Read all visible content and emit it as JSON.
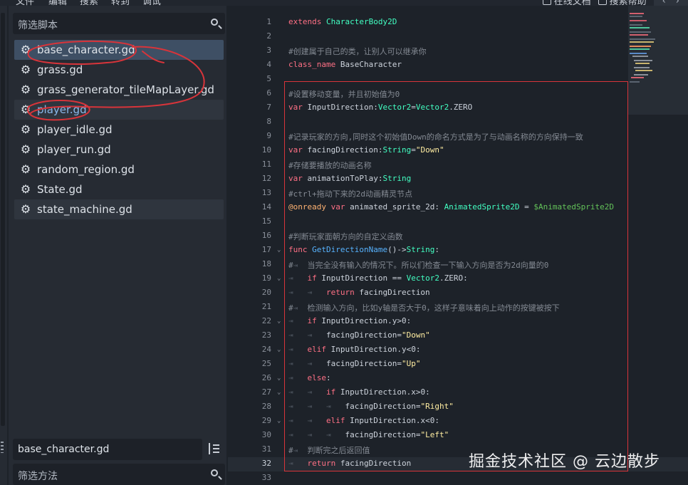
{
  "menubar": {
    "items": [
      "文件",
      "编辑",
      "搜索",
      "转到",
      "调试"
    ],
    "online_docs": "在线文档",
    "search_help": "搜索帮助",
    "nav_back": "‹",
    "nav_forward": "›"
  },
  "script_panel": {
    "filter_placeholder": "筛选脚本",
    "files": [
      {
        "name": "base_character.gd",
        "icon": "gear-icon",
        "state": "selected"
      },
      {
        "name": "grass.gd",
        "icon": "gear-icon",
        "state": "normal"
      },
      {
        "name": "grass_generator_tileMapLayer.gd",
        "icon": "gear-icon",
        "state": "normal"
      },
      {
        "name": "player.gd",
        "icon": "gear-icon",
        "state": "shaded"
      },
      {
        "name": "player_idle.gd",
        "icon": "gear-icon",
        "state": "normal"
      },
      {
        "name": "player_run.gd",
        "icon": "gear-icon",
        "state": "normal"
      },
      {
        "name": "random_region.gd",
        "icon": "gear-icon",
        "state": "normal"
      },
      {
        "name": "State.gd",
        "icon": "gear-icon",
        "state": "normal"
      },
      {
        "name": "state_machine.gd",
        "icon": "gear-icon",
        "state": "shaded"
      }
    ],
    "current_script": "base_character.gd",
    "method_filter_placeholder": "筛选方法"
  },
  "editor": {
    "current_line": 32,
    "lines": [
      {
        "n": "1",
        "fold": "",
        "segments": [
          {
            "c": "kw",
            "t": "extends "
          },
          {
            "c": "typ",
            "t": "CharacterBody2D"
          }
        ]
      },
      {
        "n": "2",
        "fold": "",
        "segments": []
      },
      {
        "n": "3",
        "fold": "",
        "segments": [
          {
            "c": "cmt",
            "t": "#创建属于自己的类，让别人可以继承你"
          }
        ]
      },
      {
        "n": "4",
        "fold": "",
        "segments": [
          {
            "c": "kw",
            "t": "class_name "
          },
          {
            "c": "",
            "t": "BaseCharacter"
          }
        ]
      },
      {
        "n": "5",
        "fold": "",
        "segments": []
      },
      {
        "n": "6",
        "fold": "",
        "segments": [
          {
            "c": "cmt",
            "t": "#设置移动变量，并且初始值为0"
          }
        ]
      },
      {
        "n": "7",
        "fold": "",
        "segments": [
          {
            "c": "kw",
            "t": "var "
          },
          {
            "c": "",
            "t": "InputDirection:"
          },
          {
            "c": "typ",
            "t": "Vector2"
          },
          {
            "c": "",
            "t": "="
          },
          {
            "c": "typ",
            "t": "Vector2"
          },
          {
            "c": "",
            "t": ".ZERO"
          }
        ]
      },
      {
        "n": "8",
        "fold": "",
        "segments": []
      },
      {
        "n": "9",
        "fold": "",
        "segments": [
          {
            "c": "cmt",
            "t": "#记录玩家的方向,同时这个初始值Down的命名方式是为了与动画名称的方向保持一致"
          }
        ]
      },
      {
        "n": "10",
        "fold": "",
        "segments": [
          {
            "c": "kw",
            "t": "var "
          },
          {
            "c": "",
            "t": "facingDirection:"
          },
          {
            "c": "typ",
            "t": "String"
          },
          {
            "c": "",
            "t": "="
          },
          {
            "c": "str",
            "t": "\"Down\""
          }
        ]
      },
      {
        "n": "11",
        "fold": "",
        "segments": [
          {
            "c": "cmt",
            "t": "#存储要播放的动画名称"
          }
        ]
      },
      {
        "n": "12",
        "fold": "",
        "segments": [
          {
            "c": "kw",
            "t": "var "
          },
          {
            "c": "",
            "t": "animationToPlay:"
          },
          {
            "c": "typ",
            "t": "String"
          }
        ]
      },
      {
        "n": "13",
        "fold": "",
        "segments": [
          {
            "c": "cmt",
            "t": "#ctrl+拖动下来的2d动画精灵节点"
          }
        ]
      },
      {
        "n": "14",
        "fold": "",
        "segments": [
          {
            "c": "ann",
            "t": "@onready "
          },
          {
            "c": "kw",
            "t": "var "
          },
          {
            "c": "",
            "t": "animated_sprite_2d: "
          },
          {
            "c": "typ",
            "t": "AnimatedSprite2D"
          },
          {
            "c": "",
            "t": " = "
          },
          {
            "c": "node",
            "t": "$AnimatedSprite2D"
          }
        ]
      },
      {
        "n": "15",
        "fold": "",
        "segments": []
      },
      {
        "n": "16",
        "fold": "",
        "segments": [
          {
            "c": "cmt",
            "t": "#判断玩家面朝方向的自定义函数"
          }
        ]
      },
      {
        "n": "17",
        "fold": "v",
        "segments": [
          {
            "c": "kw",
            "t": "func "
          },
          {
            "c": "fn",
            "t": "GetDirectionName"
          },
          {
            "c": "",
            "t": "()->"
          },
          {
            "c": "typ",
            "t": "String"
          },
          {
            "c": "",
            "t": ":"
          }
        ]
      },
      {
        "n": "18",
        "fold": "",
        "segments": [
          {
            "c": "cmt",
            "t": "#"
          },
          {
            "c": "tabmark",
            "t": "⇥  "
          },
          {
            "c": "cmt",
            "t": "当完全没有输入的情况下。所以们检查一下输入方向是否为2d向量的0"
          }
        ]
      },
      {
        "n": "19",
        "fold": "v",
        "segments": [
          {
            "c": "tabmark",
            "t": "⇥   "
          },
          {
            "c": "kw",
            "t": "if "
          },
          {
            "c": "",
            "t": "InputDirection == "
          },
          {
            "c": "typ",
            "t": "Vector2"
          },
          {
            "c": "",
            "t": ".ZERO:"
          }
        ]
      },
      {
        "n": "20",
        "fold": "",
        "segments": [
          {
            "c": "tabmark",
            "t": "⇥   ⇥   "
          },
          {
            "c": "kw",
            "t": "return "
          },
          {
            "c": "",
            "t": "facingDirection"
          }
        ]
      },
      {
        "n": "21",
        "fold": "",
        "segments": [
          {
            "c": "cmt",
            "t": "#"
          },
          {
            "c": "tabmark",
            "t": "⇥  "
          },
          {
            "c": "cmt",
            "t": "检测输入方向，比如y轴是否大于0，这样子意味着向上动作的按键被按下"
          }
        ]
      },
      {
        "n": "22",
        "fold": "v",
        "segments": [
          {
            "c": "tabmark",
            "t": "⇥   "
          },
          {
            "c": "kw",
            "t": "if "
          },
          {
            "c": "",
            "t": "InputDirection.y>0:"
          }
        ]
      },
      {
        "n": "23",
        "fold": "",
        "segments": [
          {
            "c": "tabmark",
            "t": "⇥   ⇥   "
          },
          {
            "c": "",
            "t": "facingDirection="
          },
          {
            "c": "str",
            "t": "\"Down\""
          }
        ]
      },
      {
        "n": "24",
        "fold": "v",
        "segments": [
          {
            "c": "tabmark",
            "t": "⇥   "
          },
          {
            "c": "kw",
            "t": "elif "
          },
          {
            "c": "",
            "t": "InputDirection.y<0:"
          }
        ]
      },
      {
        "n": "25",
        "fold": "",
        "segments": [
          {
            "c": "tabmark",
            "t": "⇥   ⇥   "
          },
          {
            "c": "",
            "t": "facingDirection="
          },
          {
            "c": "str",
            "t": "\"Up\""
          }
        ]
      },
      {
        "n": "26",
        "fold": "v",
        "segments": [
          {
            "c": "tabmark",
            "t": "⇥   "
          },
          {
            "c": "kw",
            "t": "else"
          },
          {
            "c": "",
            "t": ":"
          }
        ]
      },
      {
        "n": "27",
        "fold": "v",
        "segments": [
          {
            "c": "tabmark",
            "t": "⇥   ⇥   "
          },
          {
            "c": "kw",
            "t": "if "
          },
          {
            "c": "",
            "t": "InputDirection.x>0:"
          }
        ]
      },
      {
        "n": "28",
        "fold": "",
        "segments": [
          {
            "c": "tabmark",
            "t": "⇥   ⇥   ⇥   "
          },
          {
            "c": "",
            "t": "facingDirection="
          },
          {
            "c": "str",
            "t": "\"Right\""
          }
        ]
      },
      {
        "n": "29",
        "fold": "v",
        "segments": [
          {
            "c": "tabmark",
            "t": "⇥   ⇥   "
          },
          {
            "c": "kw",
            "t": "elif "
          },
          {
            "c": "",
            "t": "InputDirection.x<0:"
          }
        ]
      },
      {
        "n": "30",
        "fold": "",
        "segments": [
          {
            "c": "tabmark",
            "t": "⇥   ⇥   ⇥   "
          },
          {
            "c": "",
            "t": "facingDirection="
          },
          {
            "c": "str",
            "t": "\"Left\""
          }
        ]
      },
      {
        "n": "31",
        "fold": "",
        "segments": [
          {
            "c": "cmt",
            "t": "#"
          },
          {
            "c": "tabmark",
            "t": "⇥  "
          },
          {
            "c": "cmt",
            "t": "判断完之后返回值"
          }
        ]
      },
      {
        "n": "32",
        "fold": "",
        "segments": [
          {
            "c": "tabmark",
            "t": "⇥   "
          },
          {
            "c": "kw",
            "t": "return "
          },
          {
            "c": "",
            "t": "facingDirection"
          }
        ]
      },
      {
        "n": "33",
        "fold": "",
        "segments": []
      }
    ]
  },
  "watermark": "掘金技术社区 @ 云边散步",
  "colors": {
    "keyword": "#ff7085",
    "type": "#42ffc2",
    "comment": "#848a93",
    "string": "#ffeda1",
    "annotation": "#ffb373",
    "node_path": "#63c259",
    "function": "#57b3ff",
    "highlight_box": "#d8343a",
    "selection": "#3e4f64"
  }
}
